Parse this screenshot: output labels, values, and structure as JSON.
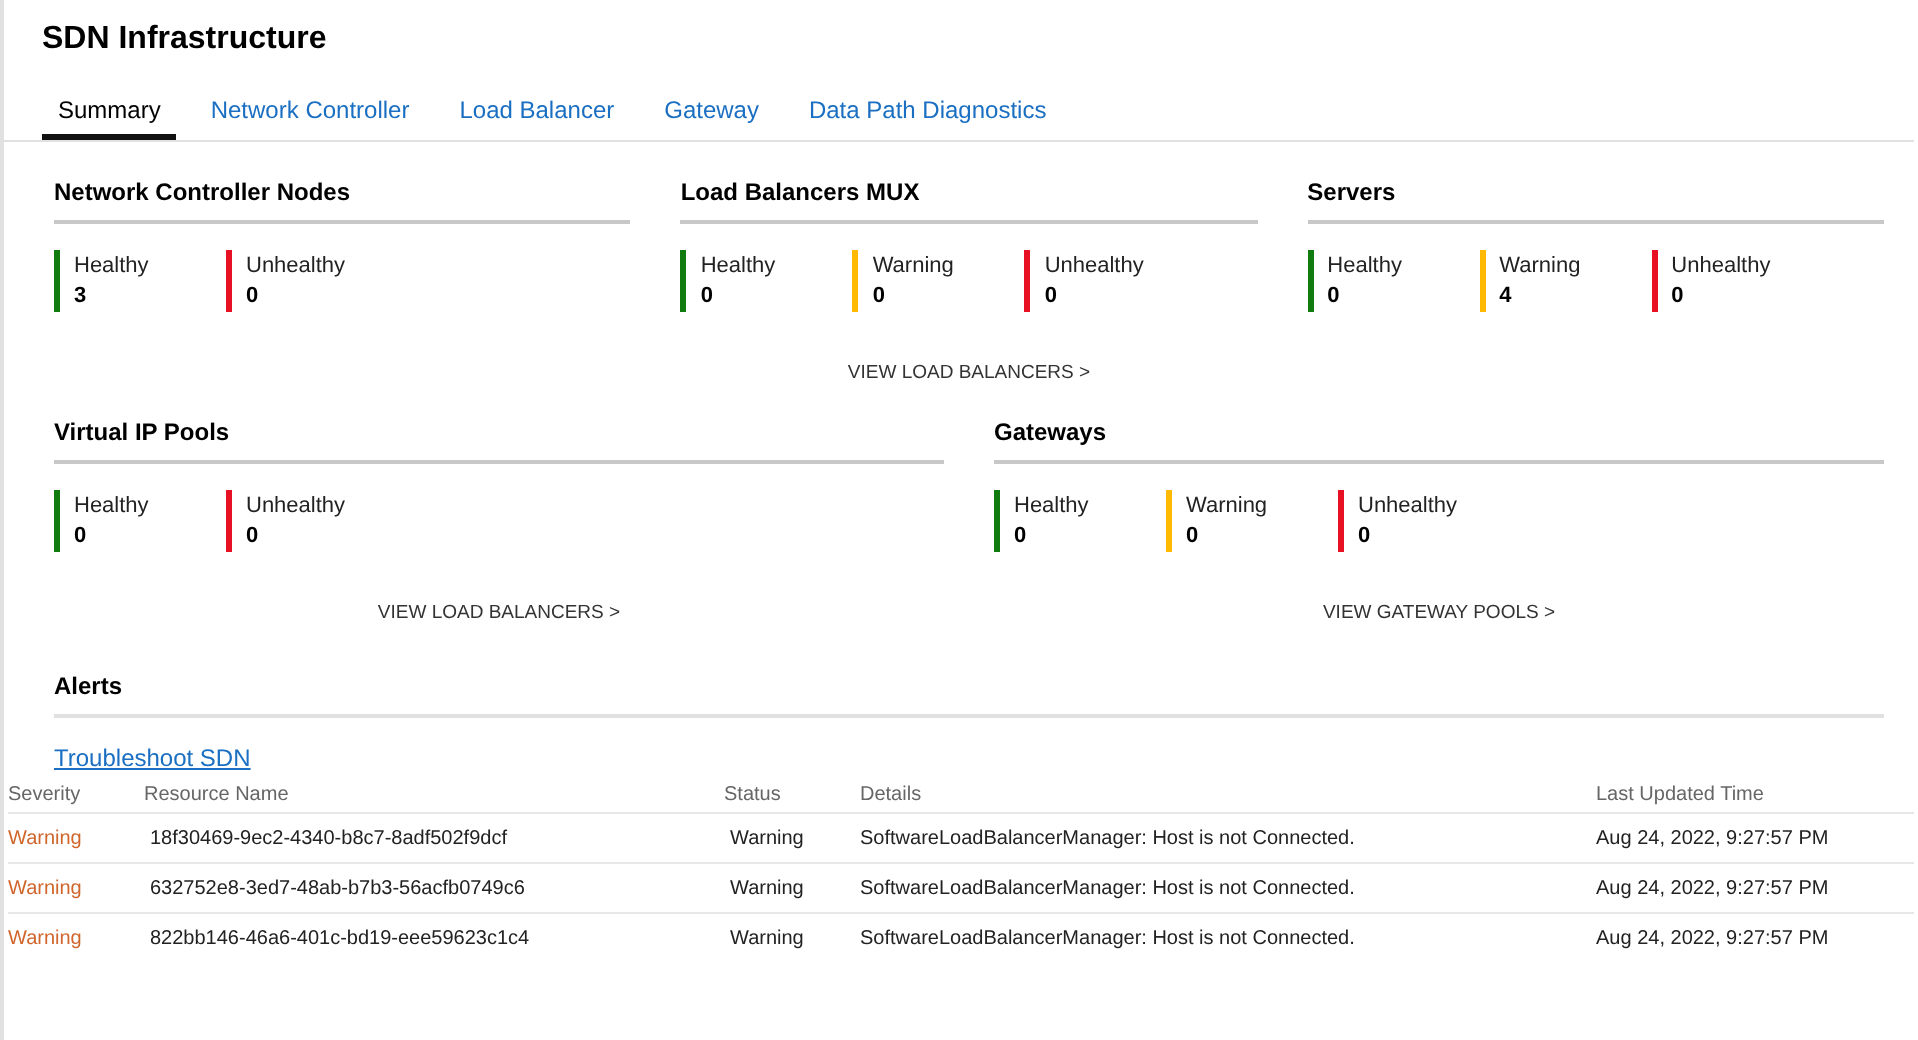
{
  "title": "SDN Infrastructure",
  "tabs": [
    {
      "label": "Summary",
      "selected": true
    },
    {
      "label": "Network Controller",
      "selected": false
    },
    {
      "label": "Load Balancer",
      "selected": false
    },
    {
      "label": "Gateway",
      "selected": false
    },
    {
      "label": "Data Path Diagnostics",
      "selected": false
    }
  ],
  "panel_rows": [
    [
      {
        "title": "Network Controller Nodes",
        "stats": [
          {
            "kind": "healthy",
            "label": "Healthy",
            "value": "3"
          },
          {
            "kind": "unhealthy",
            "label": "Unhealthy",
            "value": "0"
          }
        ]
      },
      {
        "title": "Load Balancers MUX",
        "stats": [
          {
            "kind": "healthy",
            "label": "Healthy",
            "value": "0"
          },
          {
            "kind": "warning",
            "label": "Warning",
            "value": "0"
          },
          {
            "kind": "unhealthy",
            "label": "Unhealthy",
            "value": "0"
          }
        ],
        "link": "VIEW LOAD BALANCERS >"
      },
      {
        "title": "Servers",
        "stats": [
          {
            "kind": "healthy",
            "label": "Healthy",
            "value": "0"
          },
          {
            "kind": "warning",
            "label": "Warning",
            "value": "4"
          },
          {
            "kind": "unhealthy",
            "label": "Unhealthy",
            "value": "0"
          }
        ]
      }
    ],
    [
      {
        "title": "Virtual IP Pools",
        "stats": [
          {
            "kind": "healthy",
            "label": "Healthy",
            "value": "0"
          },
          {
            "kind": "unhealthy",
            "label": "Unhealthy",
            "value": "0"
          }
        ],
        "link": "VIEW LOAD BALANCERS >"
      },
      {
        "title": "Gateways",
        "stats": [
          {
            "kind": "healthy",
            "label": "Healthy",
            "value": "0"
          },
          {
            "kind": "warning",
            "label": "Warning",
            "value": "0"
          },
          {
            "kind": "unhealthy",
            "label": "Unhealthy",
            "value": "0"
          }
        ],
        "link": "VIEW GATEWAY POOLS >"
      }
    ]
  ],
  "alerts": {
    "title": "Alerts",
    "link": "Troubleshoot SDN",
    "columns": [
      "Severity",
      "Resource Name",
      "Status",
      "Details",
      "Last Updated Time"
    ],
    "rows": [
      {
        "severity": "Warning",
        "resource_name": "18f30469-9ec2-4340-b8c7-8adf502f9dcf",
        "status": "Warning",
        "details": "SoftwareLoadBalancerManager: Host is not Connected.",
        "last_updated_time": "Aug 24, 2022, 9:27:57 PM"
      },
      {
        "severity": "Warning",
        "resource_name": "632752e8-3ed7-48ab-b7b3-56acfb0749c6",
        "status": "Warning",
        "details": "SoftwareLoadBalancerManager: Host is not Connected.",
        "last_updated_time": "Aug 24, 2022, 9:27:57 PM"
      },
      {
        "severity": "Warning",
        "resource_name": "822bb146-46a6-401c-bd19-eee59623c1c4",
        "status": "Warning",
        "details": "SoftwareLoadBalancerManager: Host is not Connected.",
        "last_updated_time": "Aug 24, 2022, 9:27:57 PM"
      }
    ]
  }
}
